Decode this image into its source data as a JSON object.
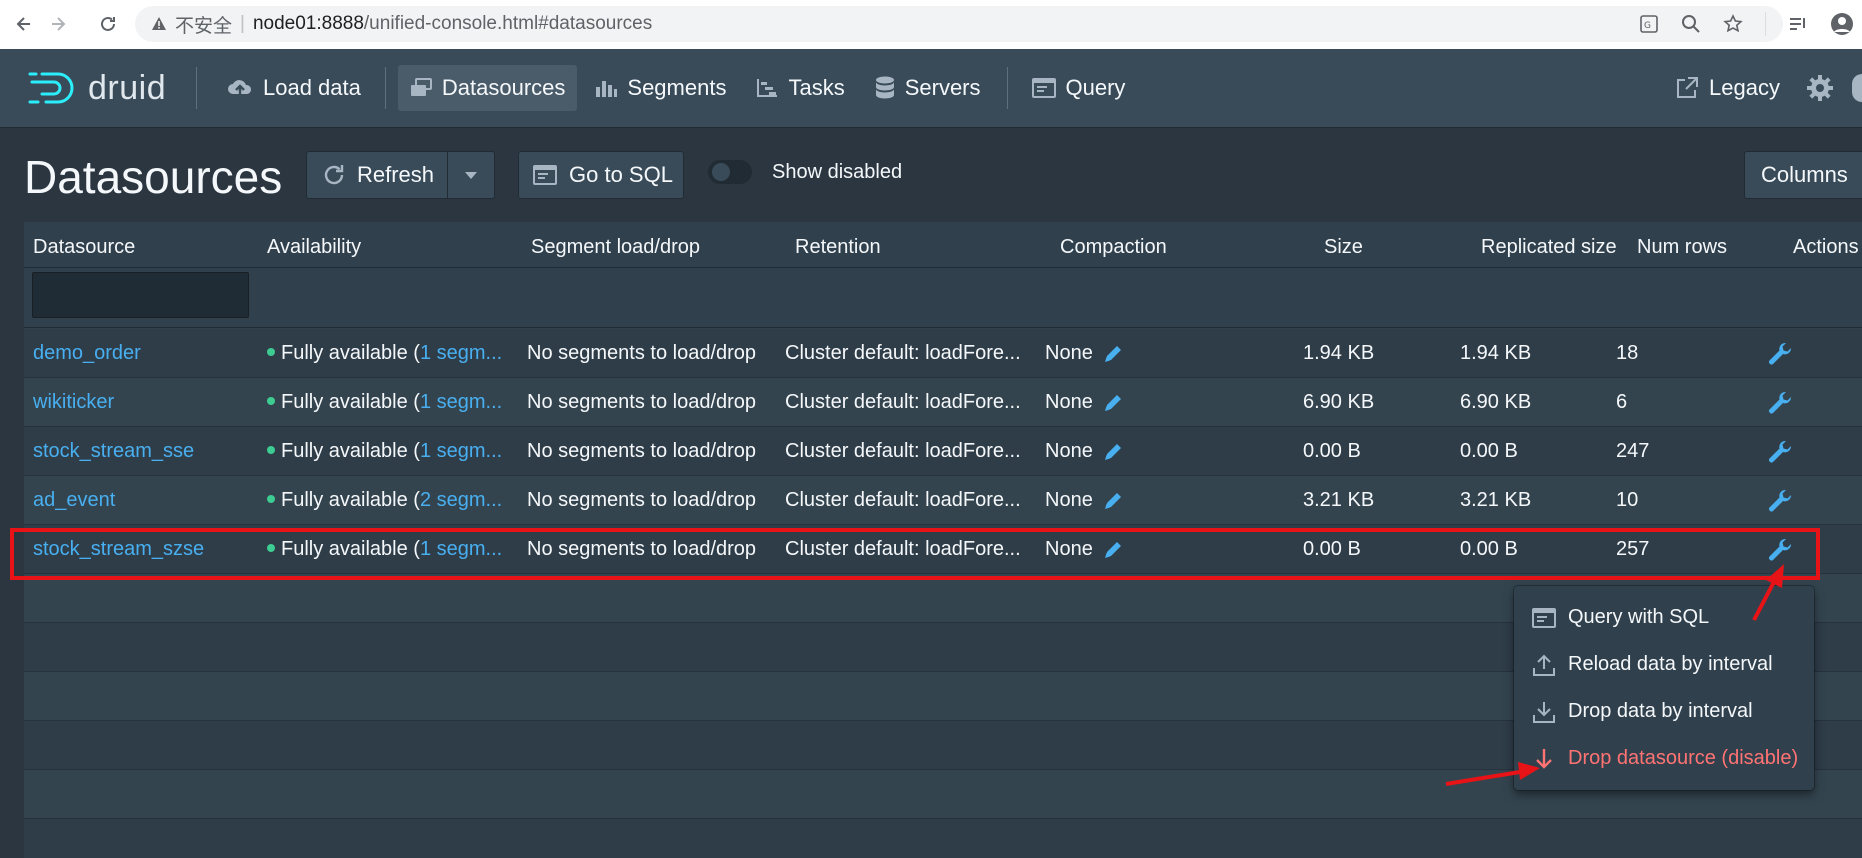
{
  "browser": {
    "insecure_label": "不安全",
    "url_host": "node01:8888",
    "url_path": "/unified-console.html#datasources"
  },
  "nav": {
    "logo_text": "druid",
    "load_data": "Load data",
    "datasources": "Datasources",
    "segments": "Segments",
    "tasks": "Tasks",
    "servers": "Servers",
    "query": "Query",
    "legacy": "Legacy"
  },
  "view": {
    "title": "Datasources",
    "refresh": "Refresh",
    "go_to_sql": "Go to SQL",
    "show_disabled": "Show disabled",
    "columns": "Columns"
  },
  "table": {
    "headers": [
      "Datasource",
      "Availability",
      "Segment load/drop",
      "Retention",
      "Compaction",
      "Size",
      "Replicated size",
      "Num rows",
      "Actions"
    ],
    "rows": [
      {
        "datasource": "demo_order",
        "avail_text": "Fully available (",
        "avail_link": "1 segm...",
        "load_drop": "No segments to load/drop",
        "retention": "Cluster default: loadFore...",
        "compaction": "None",
        "size": "1.94 KB",
        "replicated": "1.94 KB",
        "rows": "18"
      },
      {
        "datasource": "wikiticker",
        "avail_text": "Fully available (",
        "avail_link": "1 segm...",
        "load_drop": "No segments to load/drop",
        "retention": "Cluster default: loadFore...",
        "compaction": "None",
        "size": "6.90 KB",
        "replicated": "6.90 KB",
        "rows": "6"
      },
      {
        "datasource": "stock_stream_sse",
        "avail_text": "Fully available (",
        "avail_link": "1 segm...",
        "load_drop": "No segments to load/drop",
        "retention": "Cluster default: loadFore...",
        "compaction": "None",
        "size": "0.00 B",
        "replicated": "0.00 B",
        "rows": "247"
      },
      {
        "datasource": "ad_event",
        "avail_text": "Fully available (",
        "avail_link": "2 segm...",
        "load_drop": "No segments to load/drop",
        "retention": "Cluster default: loadFore...",
        "compaction": "None",
        "size": "3.21 KB",
        "replicated": "3.21 KB",
        "rows": "10"
      },
      {
        "datasource": "stock_stream_szse",
        "avail_text": "Fully available (",
        "avail_link": "1 segm...",
        "load_drop": "No segments to load/drop",
        "retention": "Cluster default: loadFore...",
        "compaction": "None",
        "size": "0.00 B",
        "replicated": "0.00 B",
        "rows": "257"
      }
    ]
  },
  "menu": {
    "query_sql": "Query with SQL",
    "reload": "Reload data by interval",
    "drop_interval": "Drop data by interval",
    "drop_ds": "Drop datasource (disable)"
  },
  "colors": {
    "link": "#48aff0",
    "danger": "#ff7373",
    "annotation": "#e81316"
  }
}
